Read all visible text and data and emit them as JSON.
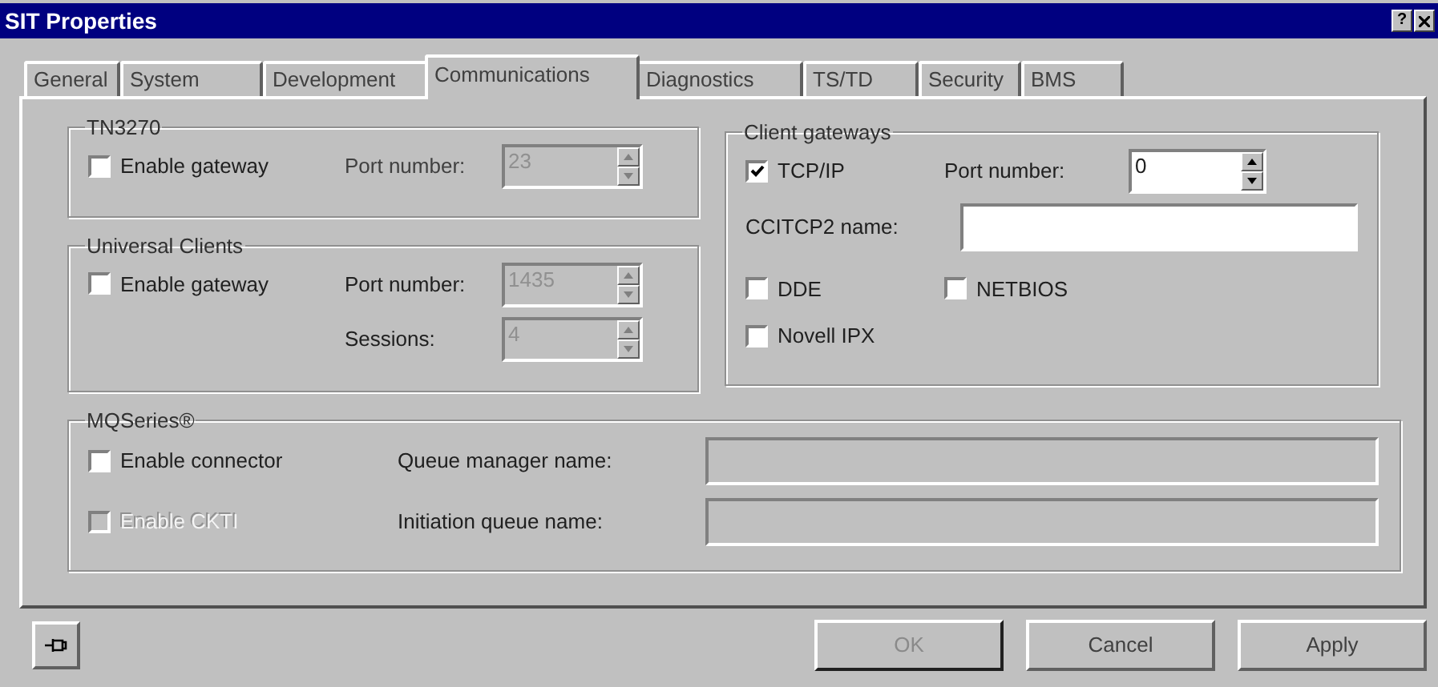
{
  "window": {
    "title": "SIT Properties",
    "help_button": "?"
  },
  "tabs": [
    {
      "label": "General",
      "selected": false
    },
    {
      "label": "System",
      "selected": false
    },
    {
      "label": "Development",
      "selected": false
    },
    {
      "label": "Communications",
      "selected": true
    },
    {
      "label": "Diagnostics",
      "selected": false
    },
    {
      "label": "TS/TD",
      "selected": false
    },
    {
      "label": "Security",
      "selected": false
    },
    {
      "label": "BMS",
      "selected": false
    }
  ],
  "tn3270": {
    "title": "TN3270",
    "enable": {
      "label": "Enable gateway",
      "checked": false,
      "disabled": false
    },
    "port": {
      "label": "Port number:",
      "value": "23",
      "disabled": true
    }
  },
  "universal_clients": {
    "title": "Universal Clients",
    "enable": {
      "label": "Enable gateway",
      "checked": false,
      "disabled": false
    },
    "port": {
      "label": "Port number:",
      "value": "1435",
      "disabled": true
    },
    "sessions": {
      "label": "Sessions:",
      "value": "4",
      "disabled": true
    }
  },
  "client_gateways": {
    "title": "Client gateways",
    "tcpip": {
      "label": "TCP/IP",
      "checked": true,
      "disabled": false
    },
    "port": {
      "label": "Port number:",
      "value": "0",
      "disabled": false
    },
    "ccitcp2": {
      "label": "CCITCP2 name:",
      "disabled": false
    },
    "options": [
      {
        "label": "DDE",
        "checked": false,
        "disabled": false
      },
      {
        "label": "NETBIOS",
        "checked": false,
        "disabled": false
      },
      {
        "label": "Novell IPX",
        "checked": false,
        "disabled": false
      }
    ]
  },
  "mqseries": {
    "title": "MQSeries®",
    "connector": {
      "label": "Enable connector",
      "checked": false,
      "disabled": false
    },
    "ckti": {
      "label": "Enable CKTI",
      "checked": false,
      "disabled": true
    },
    "queue_manager": {
      "label": "Queue manager name:",
      "disabled": true
    },
    "initiation_queue": {
      "label": "Initiation queue name:",
      "disabled": true
    }
  },
  "buttons": [
    {
      "label": "OK",
      "disabled": true
    },
    {
      "label": "Cancel",
      "disabled": false
    },
    {
      "label": "Apply",
      "disabled": false
    }
  ]
}
